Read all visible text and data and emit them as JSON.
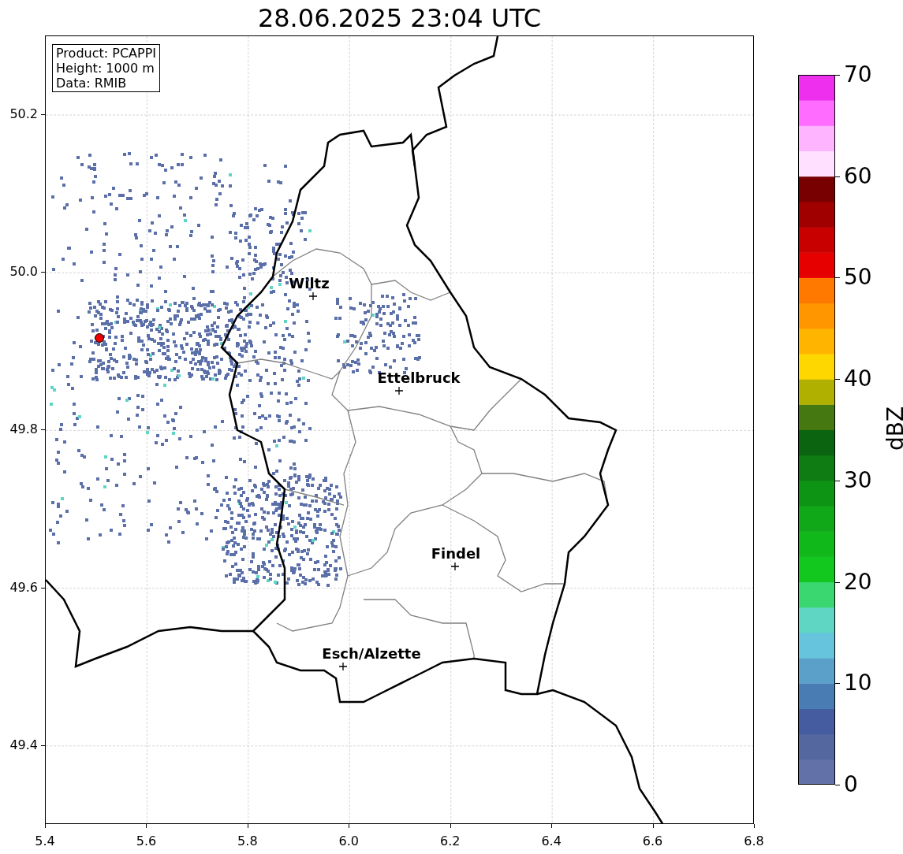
{
  "title": "28.06.2025 23:04 UTC",
  "info_box": [
    "Product: PCAPPI",
    "Height: 1000 m",
    "Data: RMIB"
  ],
  "x_ticks": [
    "5.4",
    "5.6",
    "5.8",
    "6.0",
    "6.2",
    "6.4",
    "6.6",
    "6.8"
  ],
  "y_ticks": [
    "50.2",
    "50.0",
    "49.8",
    "49.6",
    "49.4"
  ],
  "cities": [
    {
      "name": "Wiltz"
    },
    {
      "name": "Ettelbruck"
    },
    {
      "name": "Findel"
    },
    {
      "name": "Esch/Alzette"
    }
  ],
  "colorbar": {
    "label": "dBZ",
    "ticks": [
      "70",
      "60",
      "50",
      "40",
      "30",
      "20",
      "10",
      "0"
    ]
  }
}
